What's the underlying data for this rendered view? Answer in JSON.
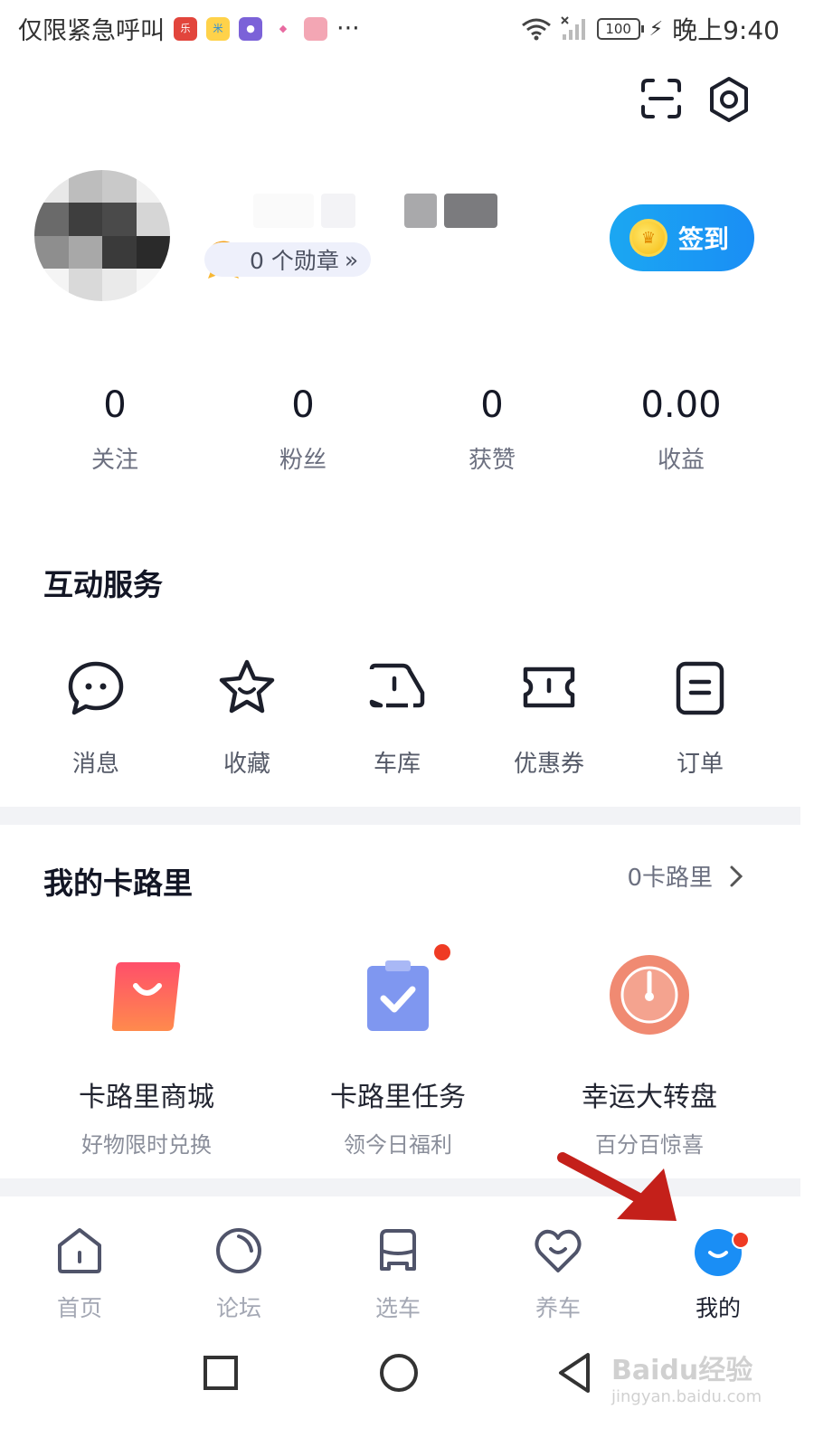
{
  "status_bar": {
    "left_text": "仅限紧急呼叫",
    "app_icons": [
      "music-app-icon",
      "rice-app-icon",
      "browser-app-icon",
      "shop-app-icon",
      "photo-app-icon"
    ],
    "more": "···",
    "battery": "100",
    "time": "晚上9:40"
  },
  "header": {
    "icons": [
      "scan-icon",
      "settings-icon"
    ]
  },
  "profile": {
    "medal_text": "0 个勋章",
    "medal_chevron": "»",
    "checkin_label": "签到"
  },
  "stats": [
    {
      "value": "0",
      "label": "关注"
    },
    {
      "value": "0",
      "label": "粉丝"
    },
    {
      "value": "0",
      "label": "获赞"
    },
    {
      "value": "0.00",
      "label": "收益"
    }
  ],
  "services": {
    "title": "互动服务",
    "items": [
      {
        "label": "消息",
        "icon": "message-icon"
      },
      {
        "label": "收藏",
        "icon": "star-icon"
      },
      {
        "label": "车库",
        "icon": "garage-icon"
      },
      {
        "label": "优惠券",
        "icon": "coupon-icon"
      },
      {
        "label": "订单",
        "icon": "order-icon"
      }
    ]
  },
  "calories": {
    "title": "我的卡路里",
    "link_text": "0卡路里",
    "items": [
      {
        "name": "卡路里商城",
        "sub": "好物限时兑换",
        "icon": "shopping-bag-icon"
      },
      {
        "name": "卡路里任务",
        "sub": "领今日福利",
        "icon": "task-clipboard-icon",
        "badge": true
      },
      {
        "name": "幸运大转盘",
        "sub": "百分百惊喜",
        "icon": "lucky-wheel-icon"
      }
    ]
  },
  "tab_bar": {
    "tabs": [
      {
        "label": "首页",
        "icon": "home-icon"
      },
      {
        "label": "论坛",
        "icon": "forum-icon"
      },
      {
        "label": "选车",
        "icon": "car-icon"
      },
      {
        "label": "养车",
        "icon": "heart-icon"
      },
      {
        "label": "我的",
        "icon": "profile-icon",
        "active": true,
        "badge": true
      }
    ]
  },
  "colors": {
    "accent": "#1a8ef5",
    "badge_red": "#ef3b24",
    "annotation_arrow": "#c4201a"
  },
  "watermark": {
    "brand": "Baidu经验",
    "url": "jingyan.baidu.com"
  }
}
